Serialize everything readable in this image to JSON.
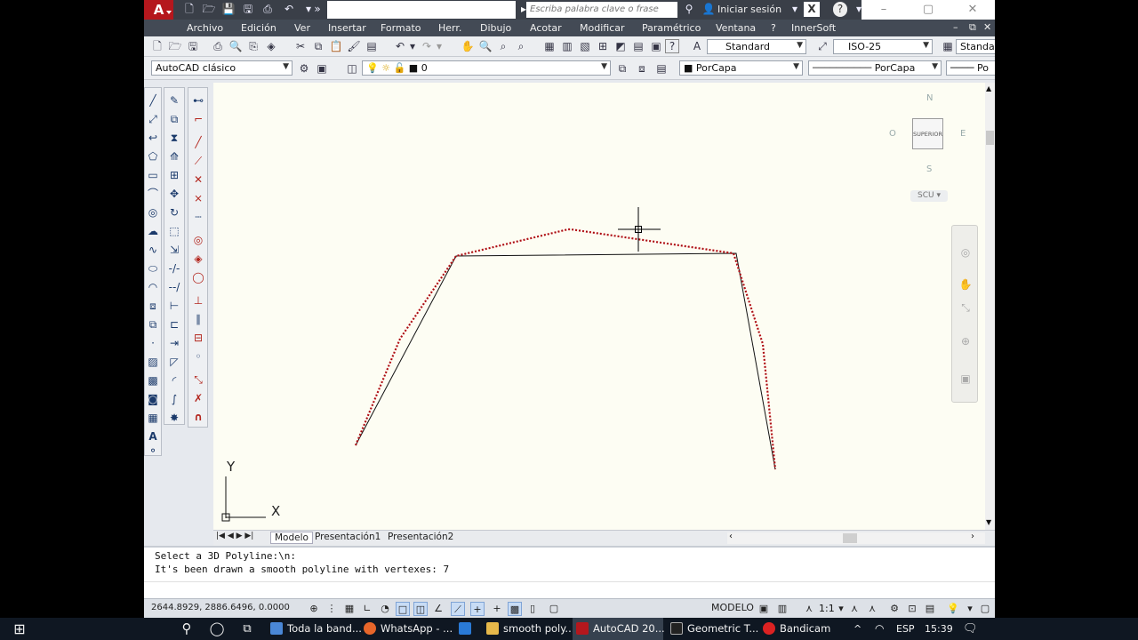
{
  "app": {
    "logo_letter": "A",
    "search_placeholder": "Escriba palabra clave o frase",
    "signin": "Iniciar sesión"
  },
  "menu": [
    "Archivo",
    "Edición",
    "Ver",
    "Insertar",
    "Formato",
    "Herr.",
    "Dibujo",
    "Acotar",
    "Modificar",
    "Paramétrico",
    "Ventana",
    "?",
    "InnerSoft"
  ],
  "toolbar": {
    "textstyle": "Standard",
    "dimstyle": "ISO-25",
    "tablestyle": "Standar"
  },
  "toolbar2": {
    "workspace": "AutoCAD clásico",
    "layer": "0",
    "color": "PorCapa",
    "linetype": "PorCapa",
    "lineweight": "Po"
  },
  "viewcube": {
    "face": "SUPERIOR",
    "north": "N",
    "south": "S",
    "east": "E",
    "west": "O",
    "ucs": "SCU"
  },
  "ucs_icon": {
    "x_label": "X",
    "y_label": "Y"
  },
  "tabs": [
    "Modelo",
    "Presentación1",
    "Presentación2"
  ],
  "command": {
    "line1": "Select a 3D Polyline:\\n:",
    "line2": "It's been drawn a smooth polyline with vertexes: 7"
  },
  "status": {
    "coords": "2644.8929, 2886.6496, 0.0000",
    "space": "MODELO",
    "scale": "1:1"
  },
  "taskbar": {
    "items": [
      "Toda la band...",
      "WhatsApp - ...",
      "smooth poly...",
      "AutoCAD 20...",
      "Geometric T...",
      "Bandicam"
    ],
    "lang": "ESP",
    "time": "15:39"
  },
  "drawing": {
    "vertex_count": 7,
    "colors": {
      "original_polyline": "#111111",
      "smooth_polyline": "#c0131a",
      "canvas": "#fdfdf3"
    }
  }
}
